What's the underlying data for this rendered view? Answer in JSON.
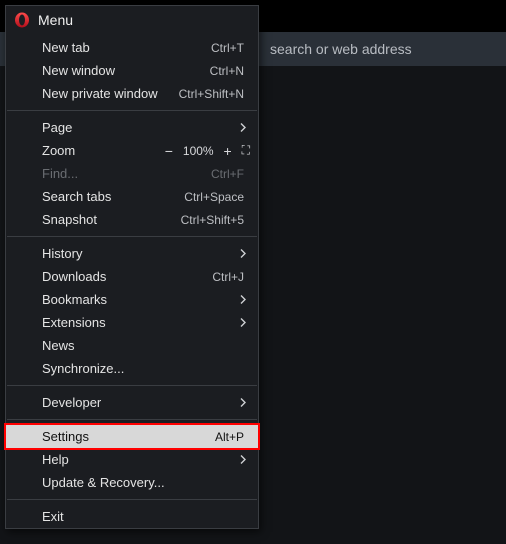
{
  "address_bar": {
    "placeholder_visible": "search or web address"
  },
  "menu": {
    "title": "Menu",
    "items": {
      "new_tab": {
        "label": "New tab",
        "shortcut": "Ctrl+T"
      },
      "new_window": {
        "label": "New window",
        "shortcut": "Ctrl+N"
      },
      "new_private": {
        "label": "New private window",
        "shortcut": "Ctrl+Shift+N"
      },
      "page": {
        "label": "Page"
      },
      "zoom": {
        "label": "Zoom",
        "value": "100%"
      },
      "find": {
        "label": "Find...",
        "shortcut": "Ctrl+F"
      },
      "search_tabs": {
        "label": "Search tabs",
        "shortcut": "Ctrl+Space"
      },
      "snapshot": {
        "label": "Snapshot",
        "shortcut": "Ctrl+Shift+5"
      },
      "history": {
        "label": "History"
      },
      "downloads": {
        "label": "Downloads",
        "shortcut": "Ctrl+J"
      },
      "bookmarks": {
        "label": "Bookmarks"
      },
      "extensions": {
        "label": "Extensions"
      },
      "news": {
        "label": "News"
      },
      "synchronize": {
        "label": "Synchronize..."
      },
      "developer": {
        "label": "Developer"
      },
      "settings": {
        "label": "Settings",
        "shortcut": "Alt+P"
      },
      "help": {
        "label": "Help"
      },
      "update": {
        "label": "Update & Recovery..."
      },
      "exit": {
        "label": "Exit"
      }
    }
  }
}
